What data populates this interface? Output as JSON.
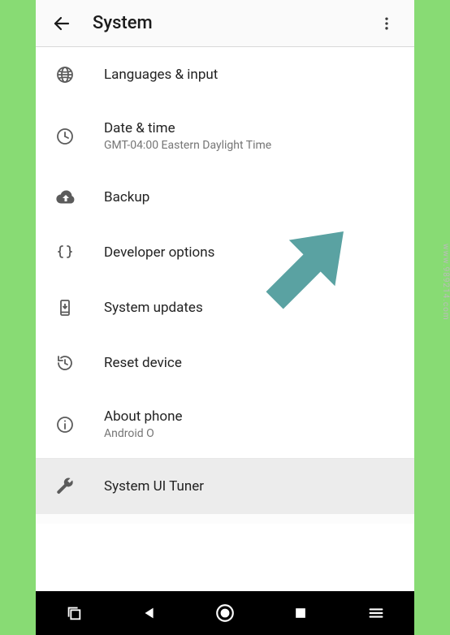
{
  "header": {
    "title": "System"
  },
  "items": {
    "languages": {
      "label": "Languages & input"
    },
    "datetime": {
      "label": "Date & time",
      "sub": "GMT-04:00 Eastern Daylight Time"
    },
    "backup": {
      "label": "Backup"
    },
    "developer": {
      "label": "Developer options"
    },
    "updates": {
      "label": "System updates"
    },
    "reset": {
      "label": "Reset device"
    },
    "about": {
      "label": "About phone",
      "sub": "Android O"
    },
    "uituner": {
      "label": "System UI Tuner"
    }
  },
  "colors": {
    "arrow": "#5aa2a2",
    "icon": "#5b5b5b"
  },
  "watermark": "www.989214.com"
}
